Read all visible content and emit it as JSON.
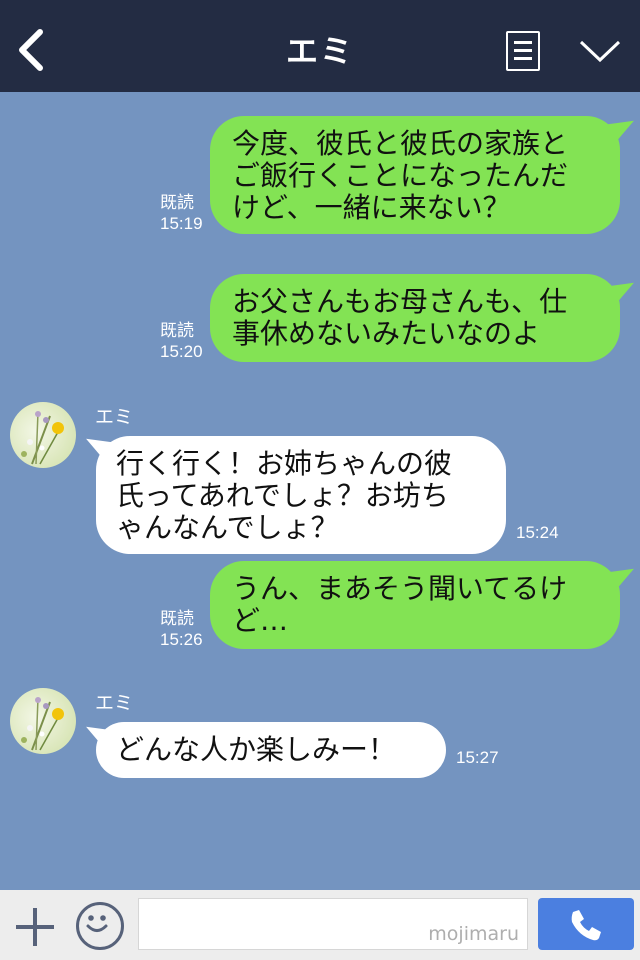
{
  "header": {
    "title": "エミ",
    "back_icon": "chevron-left-icon",
    "menu_icon": "notes-icon",
    "expand_icon": "chevron-down-icon",
    "background": "#232c43"
  },
  "chat": {
    "background": "#7494c0",
    "sent_color": "#83e354",
    "received_color": "#ffffff",
    "messages": [
      {
        "from": "me",
        "lines": [
          "今度、彼氏と彼氏の家族と",
          "ご飯行くことになったんだ",
          "けど、一緒に来ない？"
        ],
        "read": "既読",
        "time": "15:19"
      },
      {
        "from": "me",
        "lines": [
          "お父さんもお母さんも、仕",
          "事休めないみたいなのよ"
        ],
        "read": "既読",
        "time": "15:20"
      },
      {
        "from": "エミ",
        "name": "エミ",
        "lines": [
          "行く行く！お姉ちゃんの彼",
          "氏ってあれでしょ？お坊ち",
          "ゃんなんでしょ？"
        ],
        "time": "15:24"
      },
      {
        "from": "me",
        "lines": [
          "うん、まあそう聞いてるけ",
          "ど…"
        ],
        "read": "既読",
        "time": "15:26"
      },
      {
        "from": "エミ",
        "name": "エミ",
        "lines": [
          "どんな人か楽しみー！"
        ],
        "time": "15:27"
      }
    ]
  },
  "footer": {
    "plus_icon": "plus-icon",
    "emoji_icon": "smiley-icon",
    "input_value": "",
    "watermark": "mojimaru",
    "call_icon": "phone-icon",
    "call_color": "#4b7fe0"
  }
}
